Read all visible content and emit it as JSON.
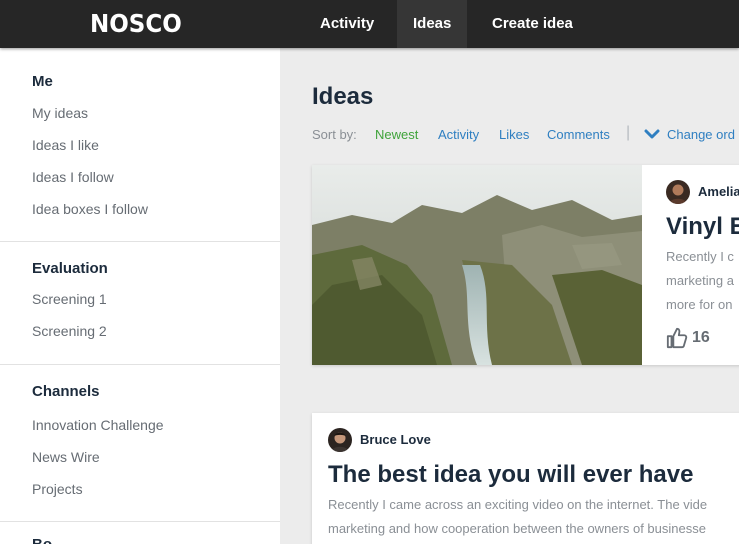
{
  "header": {
    "logo": "NOSCO",
    "nav": [
      {
        "label": "Activity"
      },
      {
        "label": "Ideas"
      },
      {
        "label": "Create idea"
      }
    ]
  },
  "sidebar": {
    "sections": [
      {
        "heading": "Me",
        "items": [
          "My ideas",
          "Ideas I like",
          "Ideas I follow",
          "Idea boxes I follow"
        ]
      },
      {
        "heading": "Evaluation",
        "items": [
          "Screening 1",
          "Screening 2"
        ]
      },
      {
        "heading": "Channels",
        "items": [
          "Innovation Challenge",
          "News Wire",
          "Projects"
        ]
      },
      {
        "heading": "Bo..."
      }
    ]
  },
  "main": {
    "title": "Ideas",
    "sort": {
      "label": "Sort by:",
      "options": [
        "Newest",
        "Activity",
        "Likes",
        "Comments"
      ],
      "active": "Newest",
      "separator": "|",
      "change_order": "Change ord"
    },
    "cards": [
      {
        "author": "Amelia",
        "title": "Vinyl E",
        "excerpt": [
          "Recently I c",
          "marketing a",
          "more for on"
        ],
        "likes": "16"
      },
      {
        "author": "Bruce Love",
        "title": "The best idea you will ever have",
        "excerpt": [
          "Recently I came across an exciting video on the internet. The vide",
          "marketing and how cooperation between the owners of businesse"
        ]
      }
    ]
  },
  "colors": {
    "topbar": "#262626",
    "active_nav": "#363636",
    "link": "#2f7fc1",
    "active_sort": "#3fa33a",
    "text_dark": "#1c2b3c",
    "text_muted": "#666c73",
    "background": "#ececec"
  }
}
